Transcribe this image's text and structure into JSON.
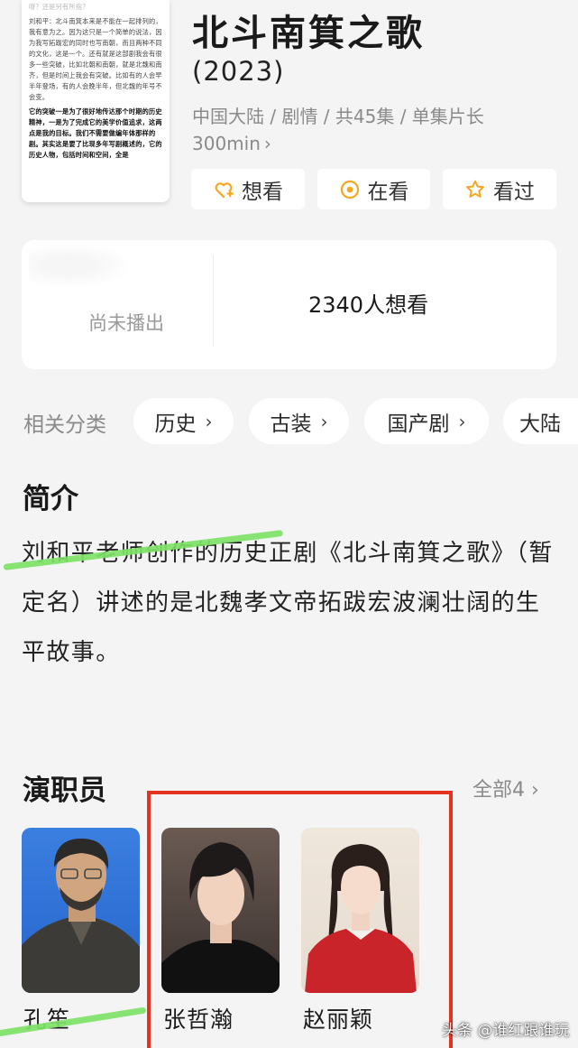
{
  "poster": {
    "lines": [
      "呀？还是另有所指？",
      "刘和平：北斗南箕本来是不能在一起排列的，我有意为之。因为这只是一个简单的说法，因为我写拓跋宏的同时也写南朝，而且两种不同的文化，这是一个。还有就是这部剧我会有很多一些突破，比如北朝和南朝，就是北魏和南齐，但是时间上我会有突破。比如有的人会早半年登场，有的人会晚半年，但北魏的年号不会变。",
      "它的突破一是为了很好地传达那个时期的历史精神，一是为了完成它的美学价值追求，这两点是我的目标。我们不需要做编年体那样的剧。其实这是要了比现多年写剧概述的，它的历史人物，包括时间和空间，全是"
    ]
  },
  "show": {
    "title": "北斗南箕之歌",
    "year": "(2023)",
    "meta_line1": "中国大陆 / 剧情 / 共45集 / 单集片长",
    "meta_line2": "300min",
    "meta_chevron": "›"
  },
  "actions": [
    {
      "label": "想看",
      "icon": "heart-plus-icon"
    },
    {
      "label": "在看",
      "icon": "target-circle-icon"
    },
    {
      "label": "看过",
      "icon": "star-icon"
    }
  ],
  "stats": {
    "left": "尚未播出",
    "right": "2340人想看"
  },
  "categories": {
    "label": "相关分类",
    "chevron": "›",
    "items": [
      "历史",
      "古装",
      "国产剧",
      "大陆"
    ]
  },
  "intro": {
    "title": "简介",
    "text": "刘和平老师创作的历史正剧《北斗南箕之歌》（暂定名）讲述的是北魏孝文帝拓跋宏波澜壮阔的生平故事。"
  },
  "cast": {
    "title": "演职员",
    "see_all": "全部4",
    "see_all_chevron": "›",
    "members": [
      "孔笙",
      "张哲瀚",
      "赵丽颖"
    ]
  },
  "watermark": "头条 @谁红跟谁玩",
  "colors": {
    "accent": "#f5a623",
    "highlight_box": "#e53322",
    "swipe_mark": "#7ee266",
    "page_bg": "#f4f4f5"
  }
}
